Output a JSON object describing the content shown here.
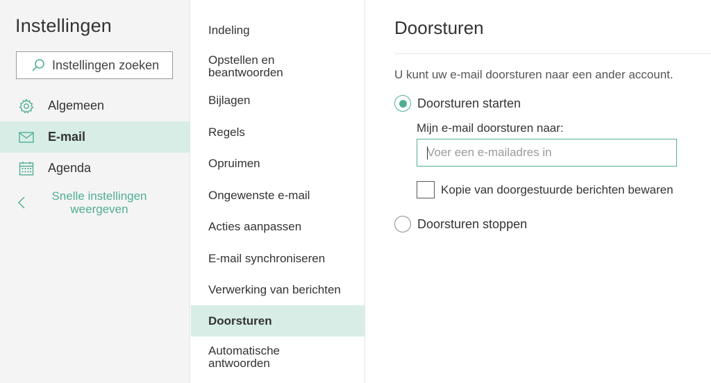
{
  "left": {
    "title": "Instellingen",
    "search": {
      "placeholder": "Instellingen zoeken",
      "icon": "search-icon"
    },
    "nav": [
      {
        "label": "Algemeen",
        "icon": "gear-icon",
        "active": false
      },
      {
        "label": "E-mail",
        "icon": "mail-icon",
        "active": true
      },
      {
        "label": "Agenda",
        "icon": "calendar-icon",
        "active": false
      }
    ],
    "quick_settings": {
      "label": "Snelle instellingen weergeven",
      "icon": "chevron-left-icon"
    }
  },
  "middle": {
    "items": [
      {
        "label": "Indeling"
      },
      {
        "label": "Opstellen en beantwoorden"
      },
      {
        "label": "Bijlagen"
      },
      {
        "label": "Regels"
      },
      {
        "label": "Opruimen"
      },
      {
        "label": "Ongewenste e-mail"
      },
      {
        "label": "Acties aanpassen"
      },
      {
        "label": "E-mail synchroniseren"
      },
      {
        "label": "Verwerking van berichten"
      },
      {
        "label": "Doorsturen",
        "active": true
      },
      {
        "label": "Automatische antwoorden"
      }
    ]
  },
  "content": {
    "heading": "Doorsturen",
    "description": "U kunt uw e-mail doorsturen naar een ander account.",
    "start_option": {
      "label": "Doorsturen starten",
      "checked": true
    },
    "forward_label": "Mijn e-mail doorsturen naar:",
    "email_input": {
      "value": "",
      "placeholder": "Voer een e-mailadres in"
    },
    "keep_copy": {
      "label": "Kopie van doorgestuurde berichten bewaren",
      "checked": false
    },
    "stop_option": {
      "label": "Doorsturen stoppen",
      "checked": false
    }
  },
  "colors": {
    "accent": "#4fae94",
    "selected_bg": "#d7ede6",
    "sidebar_bg": "#f4f4f4"
  }
}
